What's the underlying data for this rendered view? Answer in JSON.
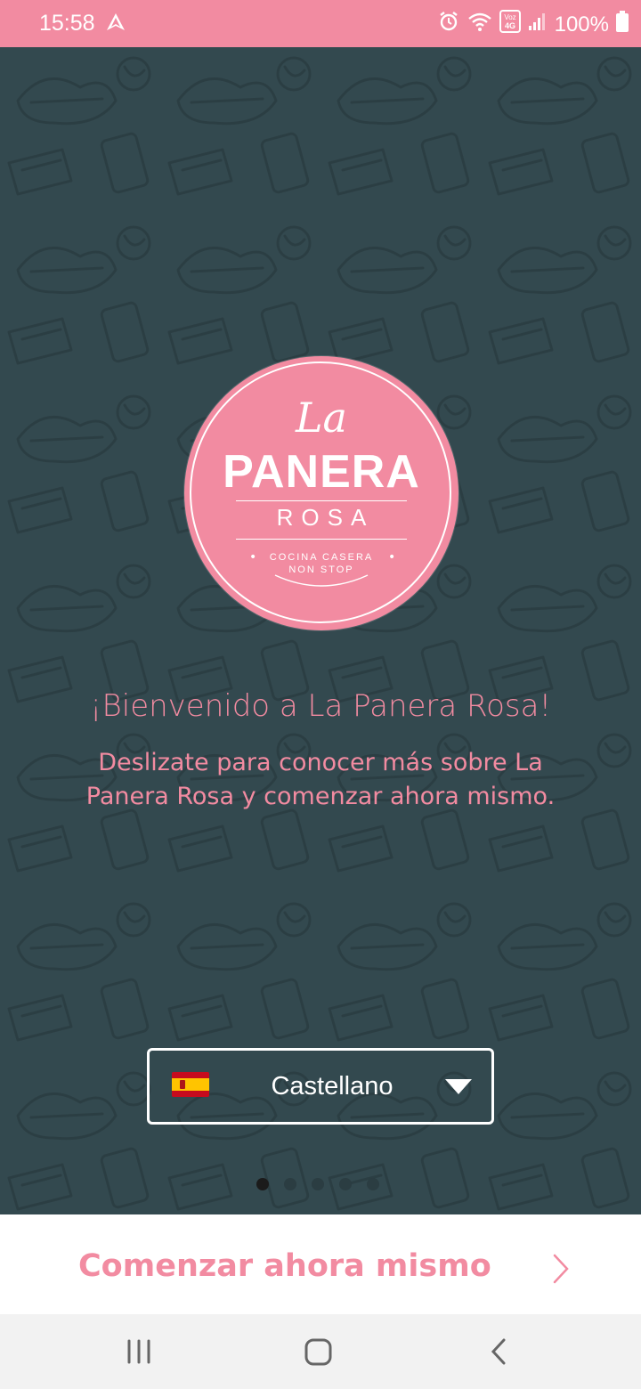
{
  "status_bar": {
    "time": "15:58",
    "battery": "100%",
    "network_badge": "Voz 4G"
  },
  "logo": {
    "line_la": "La",
    "line_panera": "PANERA",
    "line_rosa": "ROSA",
    "tagline_1": "COCINA CASERA",
    "tagline_2": "NON STOP"
  },
  "welcome_title": "¡Bienvenido a La Panera Rosa!",
  "welcome_text": "Deslizate para conocer más sobre La Panera Rosa y comenzar ahora mismo.",
  "language_select": {
    "selected": "Castellano",
    "flag_icon": "spain-flag-icon"
  },
  "pager": {
    "total": 5,
    "active": 1
  },
  "cta": {
    "label": "Comenzar ahora mismo"
  },
  "colors": {
    "brand_pink": "#f28ba1",
    "background": "#33494f",
    "white": "#ffffff"
  }
}
